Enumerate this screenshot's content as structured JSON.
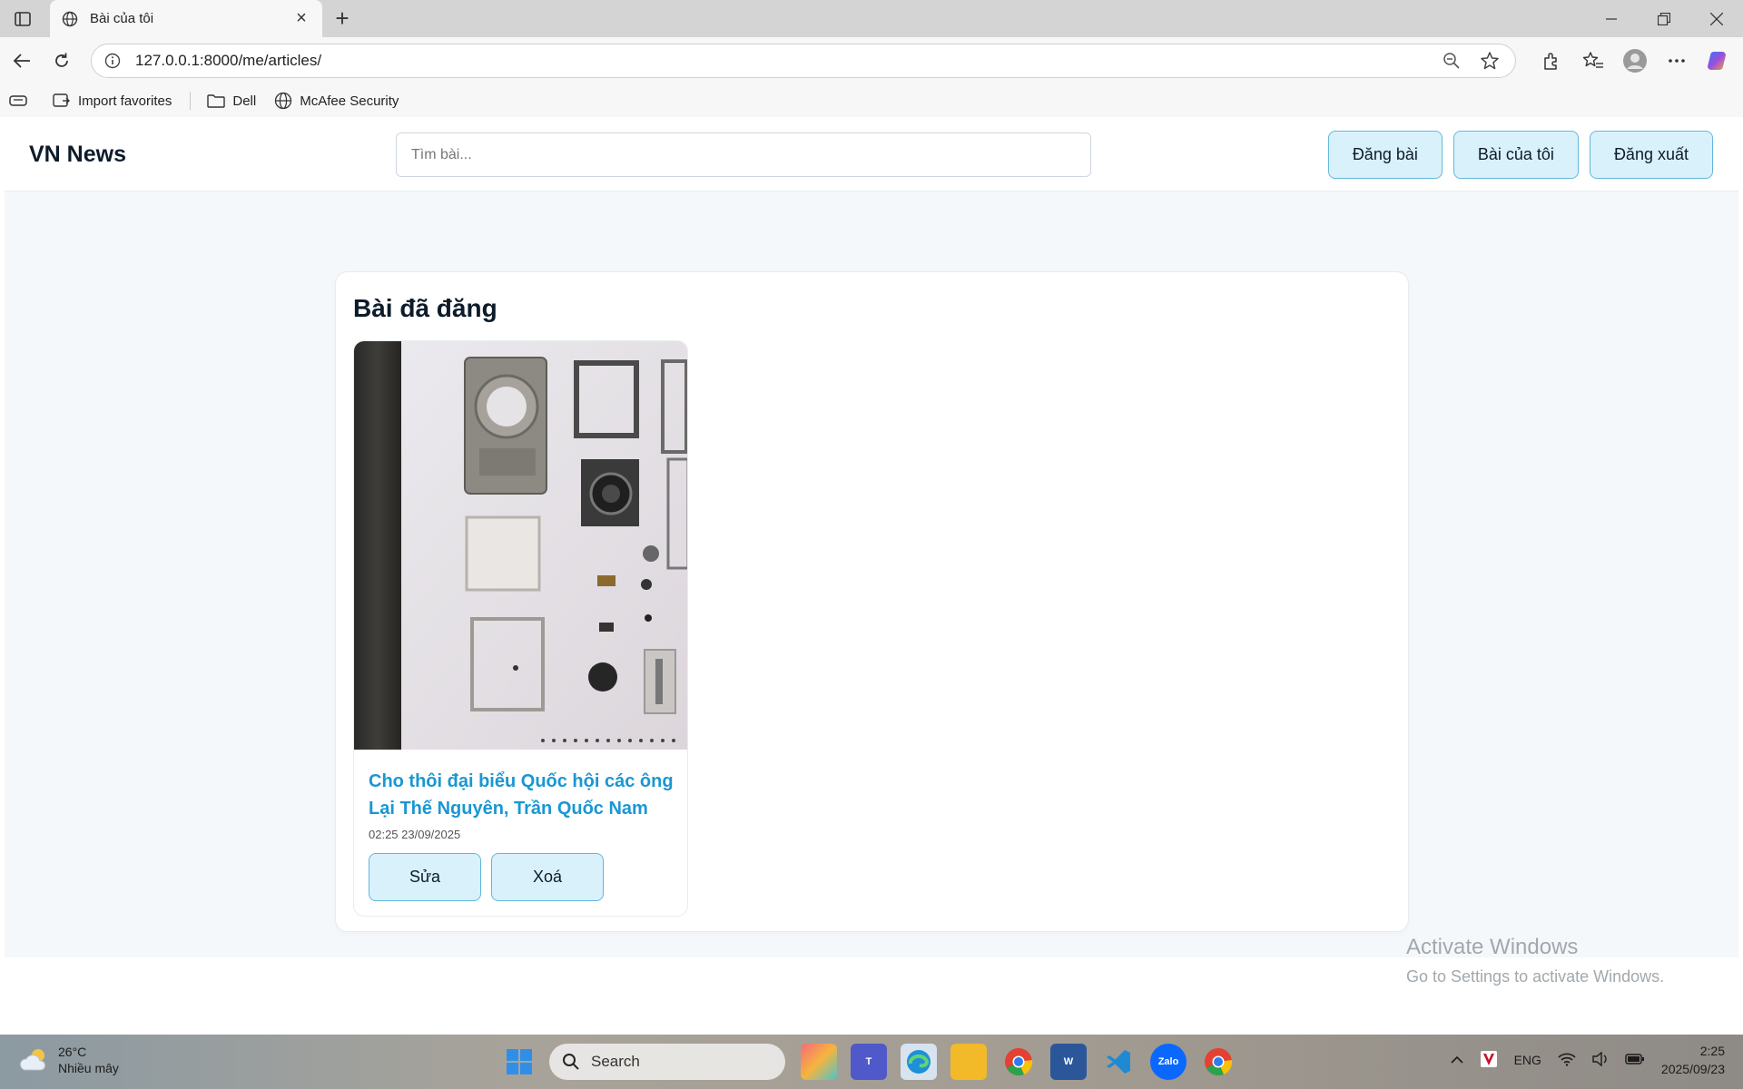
{
  "browser": {
    "tab_title": "Bài của tôi",
    "url": "127.0.0.1:8000/me/articles/",
    "bookmarks": [
      {
        "label": "Import favorites",
        "icon": "import-icon"
      },
      {
        "label": "Dell",
        "icon": "folder-icon"
      },
      {
        "label": "McAfee Security",
        "icon": "globe-icon"
      }
    ]
  },
  "site": {
    "brand": "VN News",
    "search_placeholder": "Tìm bài...",
    "nav": {
      "post": "Đăng bài",
      "my_articles": "Bài của tôi",
      "logout": "Đăng xuất"
    }
  },
  "main": {
    "section_title": "Bài đã đăng",
    "articles": [
      {
        "title": "Cho thôi đại biểu Quốc hội các ông Lại Thế Nguyên, Trần Quốc Nam",
        "date": "02:25 23/09/2025",
        "edit_label": "Sửa",
        "delete_label": "Xoá"
      }
    ]
  },
  "watermark": {
    "line1": "Activate Windows",
    "line2": "Go to Settings to activate Windows."
  },
  "taskbar": {
    "temperature": "26°C",
    "weather": "Nhiều mây",
    "search_label": "Search",
    "language": "ENG",
    "time": "2:25",
    "date": "2025/09/23"
  },
  "colors": {
    "accent": "#1a97d2",
    "button_bg": "#d9f1fb",
    "button_border": "#62b8dc",
    "page_bg": "#f5f8fb"
  }
}
